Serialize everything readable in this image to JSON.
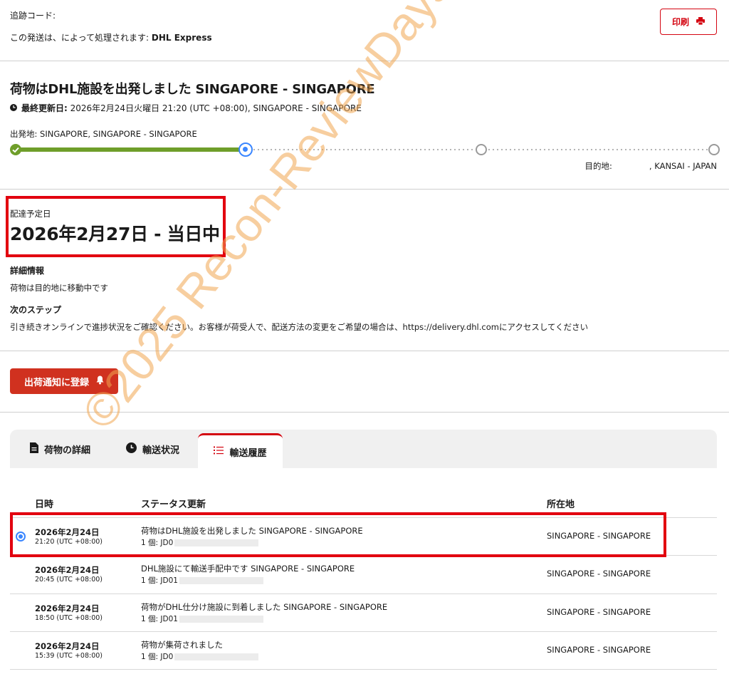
{
  "header": {
    "tracking_label": "追跡コード:",
    "carrier_prefix": "この発送は、によって処理されます: ",
    "carrier_name": "DHL Express",
    "print_label": "印刷"
  },
  "status": {
    "title": "荷物はDHL施設を出発しました SINGAPORE - SINGAPORE",
    "updated_label": "最終更新日:",
    "updated_value": " 2026年2月24日火曜日 21:20 (UTC +08:00), SINGAPORE - SINGAPORE",
    "origin": "出発地: SINGAPORE, SINGAPORE - SINGAPORE",
    "destination_label": "目的地:",
    "destination_value": ", KANSAI - JAPAN"
  },
  "delivery": {
    "eta_label": "配達予定日",
    "eta_value": "2026年2月27日 - 当日中",
    "detail_heading": "詳細情報",
    "detail_text": "荷物は目的地に移動中です",
    "next_heading": "次のステップ",
    "next_text": "引き続きオンラインで進捗状況をご確認ください。お客様が荷受人で、配送方法の変更をご希望の場合は、https://delivery.dhl.comにアクセスしてください"
  },
  "notify_label": "出荷通知に登録",
  "tabs": [
    {
      "label": "荷物の詳細"
    },
    {
      "label": "輸送状況"
    },
    {
      "label": "輸送履歴"
    }
  ],
  "history": {
    "headers": {
      "date": "日時",
      "status": "ステータス更新",
      "location": "所在地"
    },
    "rows": [
      {
        "date": "2026年2月24日",
        "time": "21:20 (UTC +08:00)",
        "status": "荷物はDHL施設を出発しました SINGAPORE - SINGAPORE",
        "pieces": "1 個: JD0",
        "location": "SINGAPORE - SINGAPORE"
      },
      {
        "date": "2026年2月24日",
        "time": "20:45 (UTC +08:00)",
        "status": "DHL施設にて輸送手配中です SINGAPORE - SINGAPORE",
        "pieces": "1 個: JD01",
        "location": "SINGAPORE - SINGAPORE"
      },
      {
        "date": "2026年2月24日",
        "time": "18:50 (UTC +08:00)",
        "status": "荷物がDHL仕分け施設に到着しました SINGAPORE - SINGAPORE",
        "pieces": "1 個: JD01",
        "location": "SINGAPORE - SINGAPORE"
      },
      {
        "date": "2026年2月24日",
        "time": "15:39 (UTC +08:00)",
        "status": "荷物が集荷されました",
        "pieces": "1 個: JD0",
        "location": "SINGAPORE - SINGAPORE"
      }
    ]
  },
  "watermark": "©2025 Recon-ReviewDays",
  "colors": {
    "accent": "#d40511",
    "button": "#d0311f",
    "progress": "#6f9e2a",
    "current": "#3a86ff",
    "highlight": "#e2000f"
  }
}
